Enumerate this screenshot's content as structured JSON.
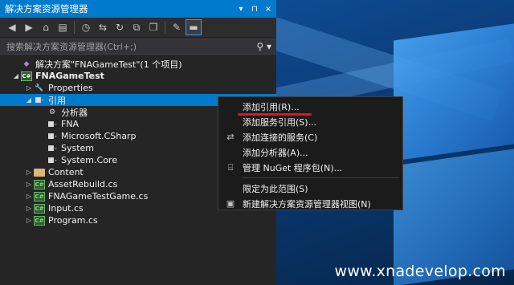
{
  "panel": {
    "title": "解决方案资源管理器",
    "title_icons": [
      "▾",
      "⊓",
      "×"
    ],
    "search_placeholder": "搜索解决方案资源管理器(Ctrl+;)"
  },
  "tree": [
    {
      "label": "解决方案\"FNAGameTest\"(1 个项目)",
      "arrow": "",
      "icon": "sln",
      "depth": 0
    },
    {
      "label": "FNAGameTest",
      "arrow": "◢",
      "icon": "proj",
      "depth": 0,
      "bold": true
    },
    {
      "label": "Properties",
      "arrow": "▷",
      "icon": "wrench",
      "depth": 1
    },
    {
      "label": "引用",
      "arrow": "◢",
      "icon": "ref",
      "depth": 1,
      "selected": true
    },
    {
      "label": "分析器",
      "arrow": "",
      "icon": "analyzer",
      "depth": 2
    },
    {
      "label": "FNA",
      "arrow": "",
      "icon": "ref",
      "depth": 2
    },
    {
      "label": "Microsoft.CSharp",
      "arrow": "",
      "icon": "ref",
      "depth": 2
    },
    {
      "label": "System",
      "arrow": "",
      "icon": "ref",
      "depth": 2
    },
    {
      "label": "System.Core",
      "arrow": "",
      "icon": "ref",
      "depth": 2
    },
    {
      "label": "Content",
      "arrow": "▷",
      "icon": "folder",
      "depth": 1
    },
    {
      "label": "AssetRebuild.cs",
      "arrow": "▷",
      "icon": "cs",
      "depth": 1
    },
    {
      "label": "FNAGameTestGame.cs",
      "arrow": "▷",
      "icon": "cs",
      "depth": 1
    },
    {
      "label": "Input.cs",
      "arrow": "▷",
      "icon": "cs",
      "depth": 1
    },
    {
      "label": "Program.cs",
      "arrow": "▷",
      "icon": "cs",
      "depth": 1
    }
  ],
  "menu": {
    "items": [
      {
        "label": "添加引用(R)...",
        "icon": ""
      },
      {
        "label": "添加服务引用(S)...",
        "icon": ""
      },
      {
        "label": "添加连接的服务(C)",
        "icon": "⇄"
      },
      {
        "label": "添加分析器(A)...",
        "icon": ""
      },
      {
        "label": "管理 NuGet 程序包(N)...",
        "icon": "⌸"
      },
      {
        "sep": true
      },
      {
        "label": "限定为此范围(S)",
        "icon": ""
      },
      {
        "label": "新建解决方案资源管理器视图(N)",
        "icon": "▣"
      }
    ]
  },
  "watermark": "www.xnadevelop.com",
  "colors": {
    "accent": "#007acc",
    "panel_bg": "#252526",
    "menu_bg": "#1b1b1c",
    "highlight_line": "#e81123"
  }
}
